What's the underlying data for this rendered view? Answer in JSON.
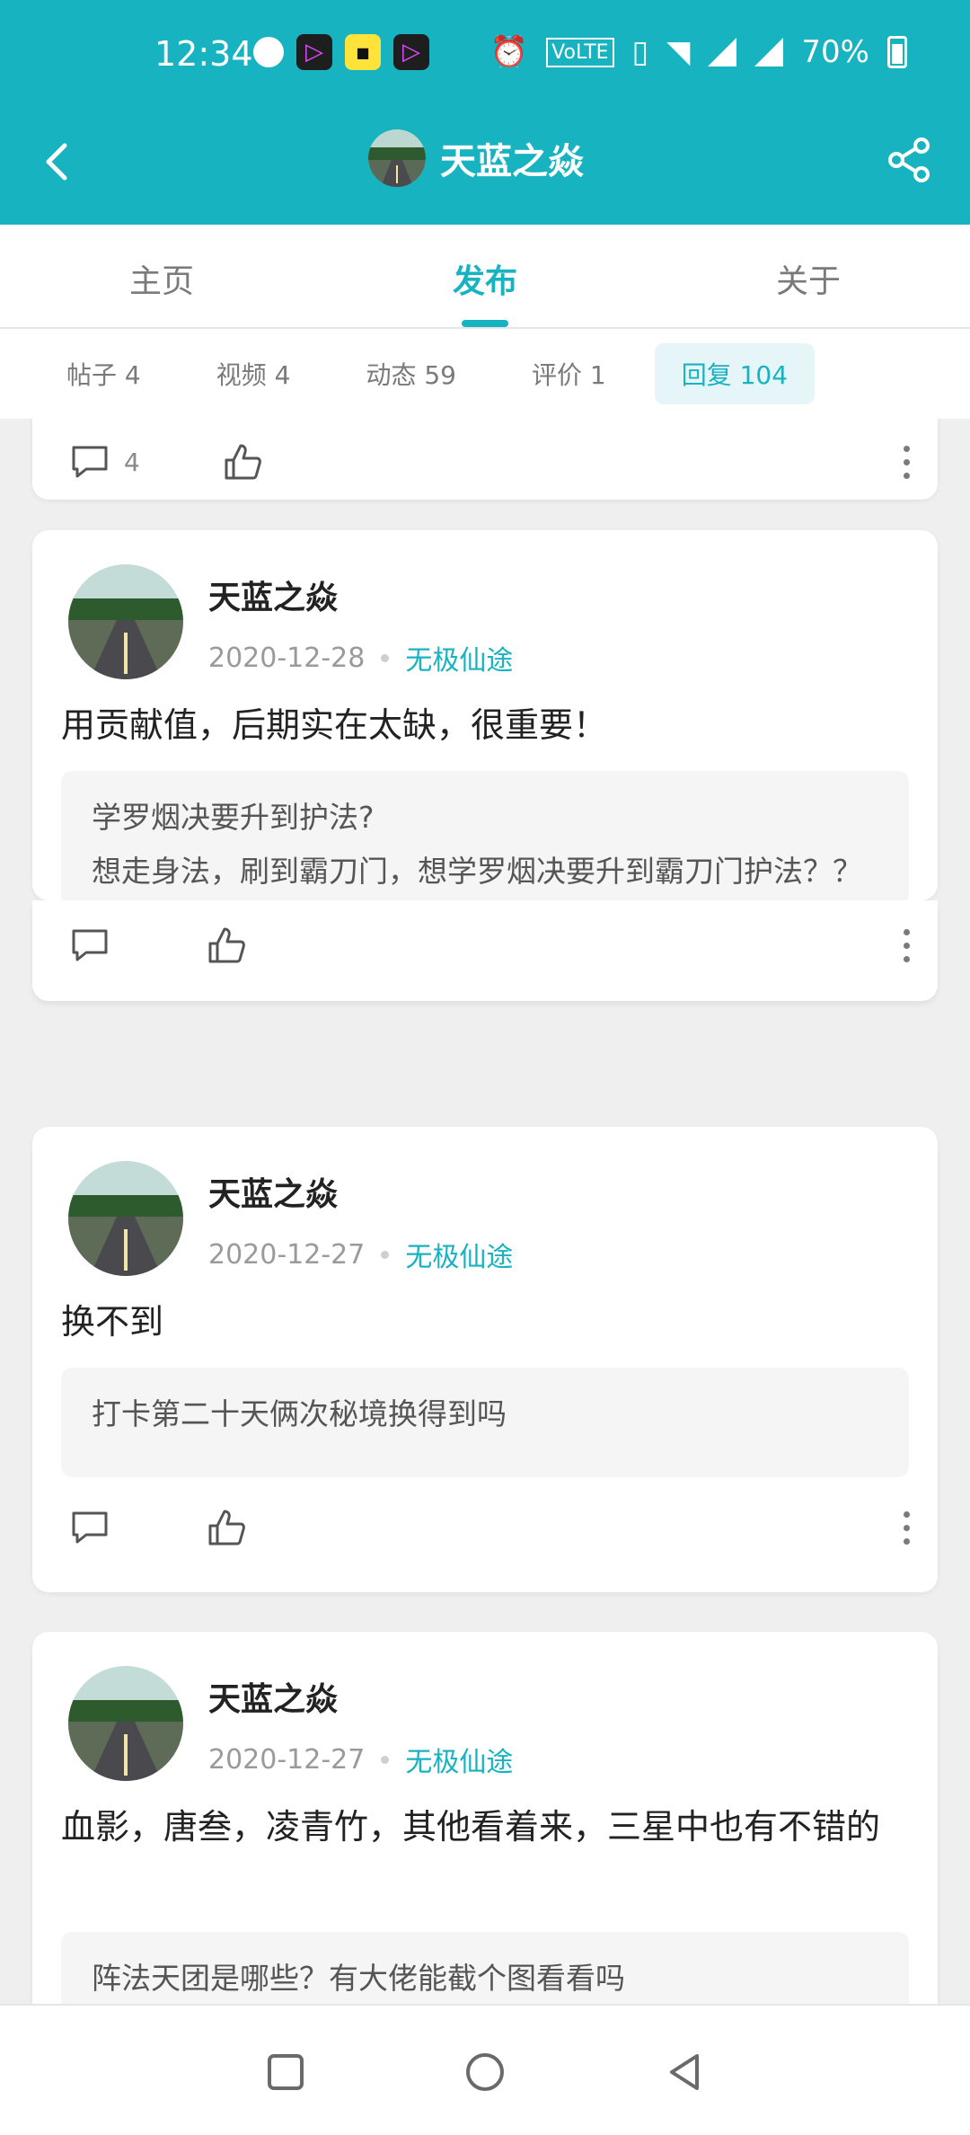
{
  "status_bar": {
    "time": "12:34",
    "battery": "70%",
    "icons": [
      "globe-icon",
      "video-app-icon",
      "yellow-app-icon",
      "video-app-icon",
      "alarm-icon",
      "volte-icon",
      "vibrate-icon",
      "wifi-icon",
      "signal-icon",
      "signal-icon",
      "battery-icon"
    ]
  },
  "header": {
    "title": "天蓝之焱",
    "back_icon": "chevron-left-icon",
    "share_icon": "share-icon"
  },
  "tabs": [
    {
      "label": "主页",
      "active": false
    },
    {
      "label": "发布",
      "active": true
    },
    {
      "label": "关于",
      "active": false
    }
  ],
  "subtabs": [
    {
      "label": "帖子 4",
      "active": false
    },
    {
      "label": "视频 4",
      "active": false
    },
    {
      "label": "动态 59",
      "active": false
    },
    {
      "label": "评价 1",
      "active": false
    },
    {
      "label": "回复 104",
      "active": true
    }
  ],
  "posts": [
    {
      "partial": true,
      "comment_count": "4"
    },
    {
      "author": "天蓝之焱",
      "date": "2020-12-28",
      "game": "无极仙途",
      "content": "用贡献值，后期实在太缺，很重要！",
      "quote": "学罗烟决要升到护法?\n想走身法，刷到霸刀门，想学罗烟决要升到霸刀门护法？？是不是有点浪费直升令牌啊啊?"
    },
    {
      "author": "天蓝之焱",
      "date": "2020-12-27",
      "game": "无极仙途",
      "content": "换不到",
      "quote": "打卡第二十天俩次秘境换得到吗"
    },
    {
      "author": "天蓝之焱",
      "date": "2020-12-27",
      "game": "无极仙途",
      "content": "血影，唐叁，凌青竹，其他看着来，三星中也有不错的",
      "quote": "阵法天团是哪些？有大佬能截个图看看吗"
    }
  ],
  "colors": {
    "accent": "#18b3c0",
    "background": "#efefef"
  }
}
